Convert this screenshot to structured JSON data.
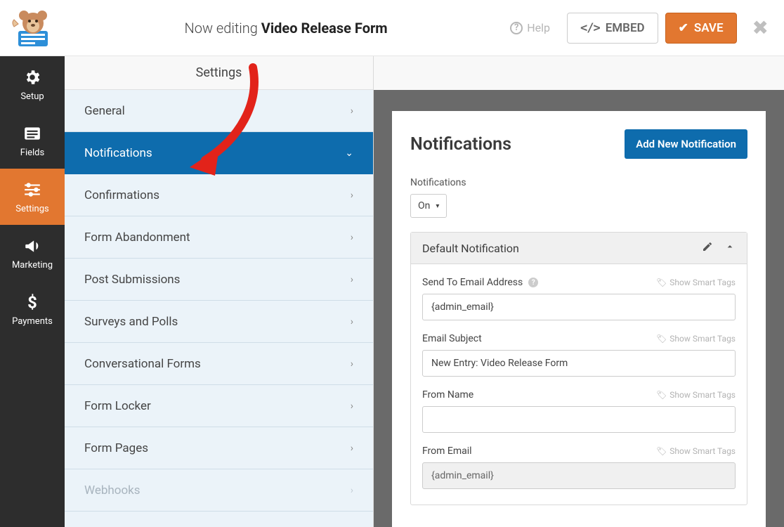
{
  "header": {
    "now_editing": "Now editing",
    "form_name": "Video Release Form",
    "help": "Help",
    "embed": "EMBED",
    "save": "SAVE"
  },
  "rail": {
    "setup": "Setup",
    "fields": "Fields",
    "settings": "Settings",
    "marketing": "Marketing",
    "payments": "Payments"
  },
  "settings": {
    "heading": "Settings",
    "items": [
      "General",
      "Notifications",
      "Confirmations",
      "Form Abandonment",
      "Post Submissions",
      "Surveys and Polls",
      "Conversational Forms",
      "Form Locker",
      "Form Pages",
      "Webhooks"
    ]
  },
  "panel": {
    "title": "Notifications",
    "add_button": "Add New Notification",
    "toggle_label": "Notifications",
    "toggle_value": "On",
    "card_title": "Default Notification",
    "smart_tags": "Show Smart Tags",
    "fields": {
      "send_to": {
        "label": "Send To Email Address",
        "value": "{admin_email}"
      },
      "subject": {
        "label": "Email Subject",
        "value": "New Entry: Video Release Form"
      },
      "from_name": {
        "label": "From Name",
        "value": ""
      },
      "from_email": {
        "label": "From Email",
        "value": "{admin_email}"
      }
    }
  }
}
